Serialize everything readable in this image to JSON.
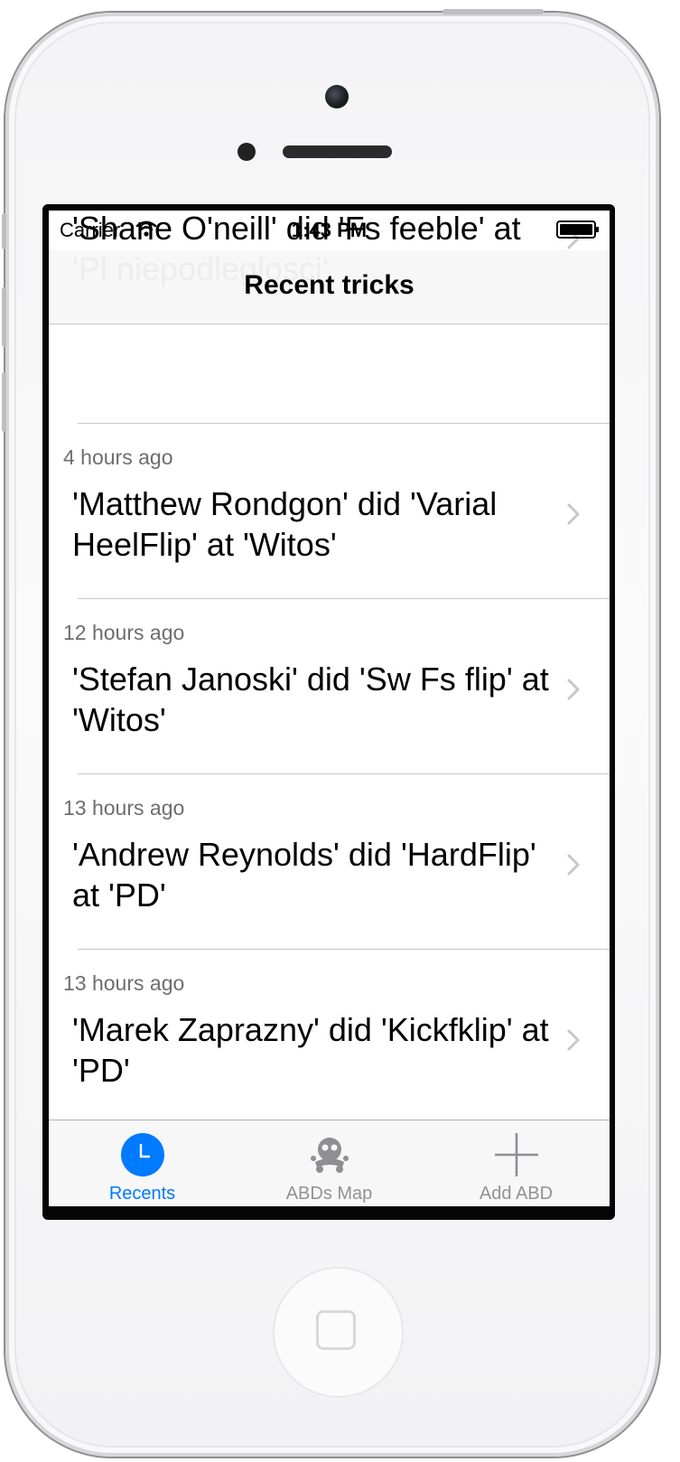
{
  "status_bar": {
    "carrier": "Carrier",
    "time": "1:43 PM",
    "wifi_icon": "wifi-icon",
    "battery_icon": "battery-icon"
  },
  "nav": {
    "title": "Recent tricks"
  },
  "partial_cell": {
    "text": "'Shane O'neill' did 'Fs feeble' at 'Pl niepodleglosci'"
  },
  "cells": [
    {
      "time": "4 hours ago",
      "text": "'Matthew Rondgon' did 'Varial HeelFlip' at 'Witos'"
    },
    {
      "time": "12 hours ago",
      "text": "'Stefan Janoski' did 'Sw Fs flip' at 'Witos'"
    },
    {
      "time": "13 hours ago",
      "text": "'Andrew Reynolds' did 'HardFlip' at 'PD'"
    },
    {
      "time": "13 hours ago",
      "text": "'Marek Zaprazny' did 'Kickfklip' at 'PD'"
    }
  ],
  "tabs": [
    {
      "label": "Recents",
      "icon": "clock-icon",
      "active": true
    },
    {
      "label": "ABDs Map",
      "icon": "skater-icon",
      "active": false
    },
    {
      "label": "Add ABD",
      "icon": "plus-icon",
      "active": false
    }
  ],
  "colors": {
    "accent": "#007aff",
    "tab_inactive": "#929292",
    "secondary_text": "#6d6d72",
    "separator": "#c8c7cc"
  }
}
